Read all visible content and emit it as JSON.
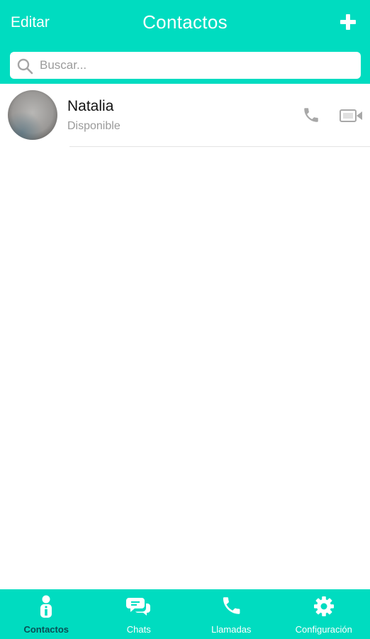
{
  "header": {
    "edit_label": "Editar",
    "title": "Contactos",
    "add_icon": "plus-icon"
  },
  "search": {
    "placeholder": "Buscar...",
    "value": ""
  },
  "contacts": [
    {
      "name": "Natalia",
      "status": "Disponible",
      "call_icon": "phone-icon",
      "video_icon": "video-camera-icon"
    }
  ],
  "bottom_nav": {
    "items": [
      {
        "label": "Contactos",
        "icon": "contact-person-icon",
        "active": true
      },
      {
        "label": "Chats",
        "icon": "chat-bubbles-icon",
        "active": false
      },
      {
        "label": "Llamadas",
        "icon": "phone-icon",
        "active": false
      },
      {
        "label": "Configuración",
        "icon": "gear-icon",
        "active": false
      }
    ]
  },
  "colors": {
    "accent": "#00dcc0",
    "active_nav": "#0a4f55",
    "muted_icon": "#a8a8a8"
  }
}
